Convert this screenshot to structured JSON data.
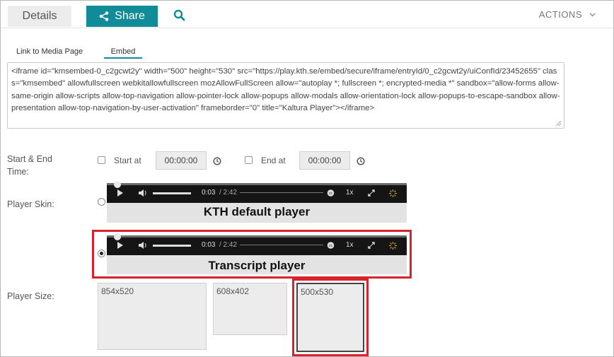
{
  "header": {
    "details_tab": "Details",
    "share_button": "Share",
    "actions_label": "ACTIONS"
  },
  "subtabs": {
    "link_label": "Link to Media Page",
    "embed_label": "Embed"
  },
  "embed_code": "<iframe id=\"kmsembed-0_c2gcwt2y\" width=\"500\" height=\"530\" src=\"https://play.kth.se/embed/secure/iframe/entryId/0_c2gcwt2y/uiConfId/23452655\" class=\"kmsembed\" allowfullscreen webkitallowfullscreen mozAllowFullScreen allow=\"autoplay *; fullscreen *; encrypted-media *\" sandbox=\"allow-forms allow-same-origin allow-scripts allow-top-navigation allow-pointer-lock allow-popups allow-modals allow-orientation-lock allow-popups-to-escape-sandbox allow-presentation allow-top-navigation-by-user-activation\" frameborder=\"0\" title=\"Kaltura Player\"></iframe>",
  "start_end": {
    "label": "Start & End Time:",
    "start_label": "Start at",
    "start_value": "00:00:00",
    "end_label": "End at",
    "end_value": "00:00:00"
  },
  "skin": {
    "label": "Player Skin:",
    "options": [
      {
        "name": "KTH default player",
        "time": "0:03",
        "duration": "/ 2:42",
        "speed": "1x",
        "selected": false
      },
      {
        "name": "Transcript player",
        "time": "0:03",
        "duration": "/ 2:42",
        "speed": "1x",
        "selected": true
      }
    ]
  },
  "size": {
    "label": "Player Size:",
    "options": [
      "854x520",
      "608x402",
      "500x530"
    ],
    "selected": "500x530"
  },
  "colors": {
    "accent": "#108b98",
    "highlight": "#d6232d"
  }
}
